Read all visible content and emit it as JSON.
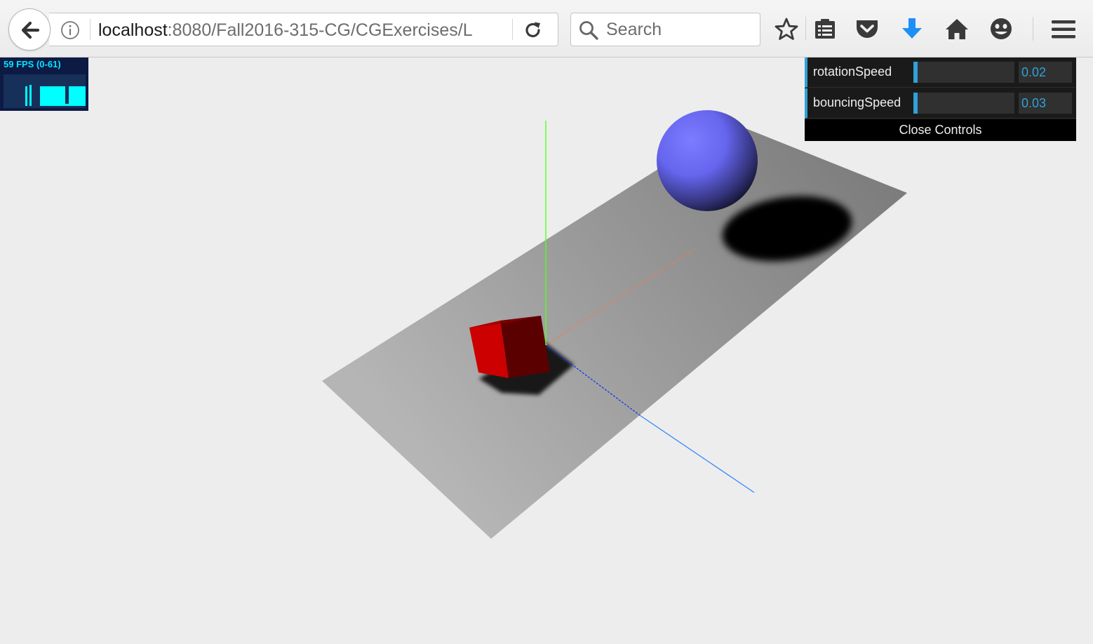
{
  "browser": {
    "url_host": "localhost",
    "url_rest": ":8080/Fall2016-315-CG/CGExercises/L",
    "search_placeholder": "Search"
  },
  "stats": {
    "label": "59 FPS (0-61)"
  },
  "controls": {
    "rows": [
      {
        "name": "rotationSpeed",
        "value": "0.02",
        "fill": 0.02
      },
      {
        "name": "bouncingSpeed",
        "value": "0.03",
        "fill": 0.03
      }
    ],
    "close_label": "Close Controls"
  },
  "icons": {
    "back": "back-arrow-icon",
    "info": "info-icon",
    "reload": "reload-icon",
    "search": "search-icon",
    "bookmark_star": "star-icon",
    "reading_list": "clipboard-icon",
    "pocket": "pocket-icon",
    "downloads": "download-icon",
    "home": "home-icon",
    "hello": "smiley-icon",
    "menu": "hamburger-menu-icon"
  },
  "colors": {
    "gui_accent": "#2fa1d6",
    "stats_text": "#00e5ff",
    "download_blue": "#1e8ff5",
    "cube_red": "#cc0000",
    "sphere_blue": "#7777ff",
    "plane_gray": "#aaaaaa"
  }
}
